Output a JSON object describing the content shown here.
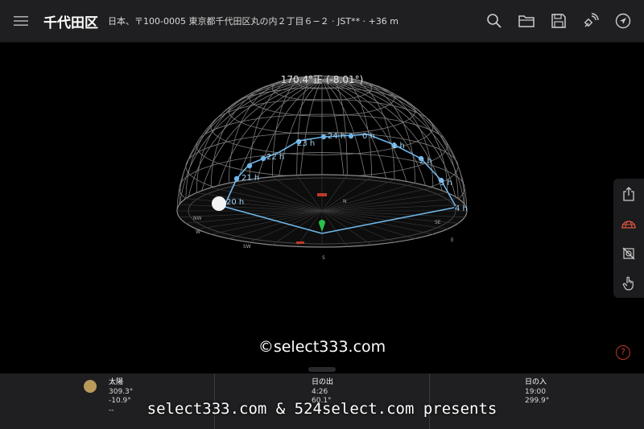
{
  "header": {
    "title": "千代田区",
    "subtitle": "日本、〒100-0005 東京都千代田区丸の内２丁目６−２ · JST** · +36 m",
    "icons": [
      "menu-icon",
      "search-icon",
      "folder-icon",
      "save-icon",
      "satellite-icon",
      "navigate-icon"
    ]
  },
  "view": {
    "heading": "170.4°正 (-8.01°)",
    "hour_labels": [
      "20 h",
      "21 h",
      "22 h",
      "23 h",
      "24 h",
      "0 h",
      "1 h",
      "2 h",
      "3 h",
      "4 h"
    ],
    "compass_labels": [
      "NW",
      "W",
      "N",
      "SW",
      "E",
      "SE",
      "S"
    ]
  },
  "side_panel": {
    "icons": [
      "share-icon",
      "dome-icon",
      "hide-sun-icon",
      "hand-icon"
    ]
  },
  "watermark": "©select333.com",
  "help_label": "?",
  "bottom": {
    "sun": {
      "label": "太陽",
      "azimuth": "309.3°",
      "altitude": "-10.9°",
      "extra": "--"
    },
    "sunrise": {
      "label": "日の出",
      "time": "4:26",
      "azimuth": "60.1°"
    },
    "sunset": {
      "label": "日の入",
      "time": "19:00",
      "azimuth": "299.9°"
    }
  },
  "presents": "select333.com & 524select.com presents",
  "colors": {
    "path": "#6fb6e8",
    "marker": "#29c14a",
    "accent_red": "#c0392b",
    "sun": "#b99a5b"
  }
}
